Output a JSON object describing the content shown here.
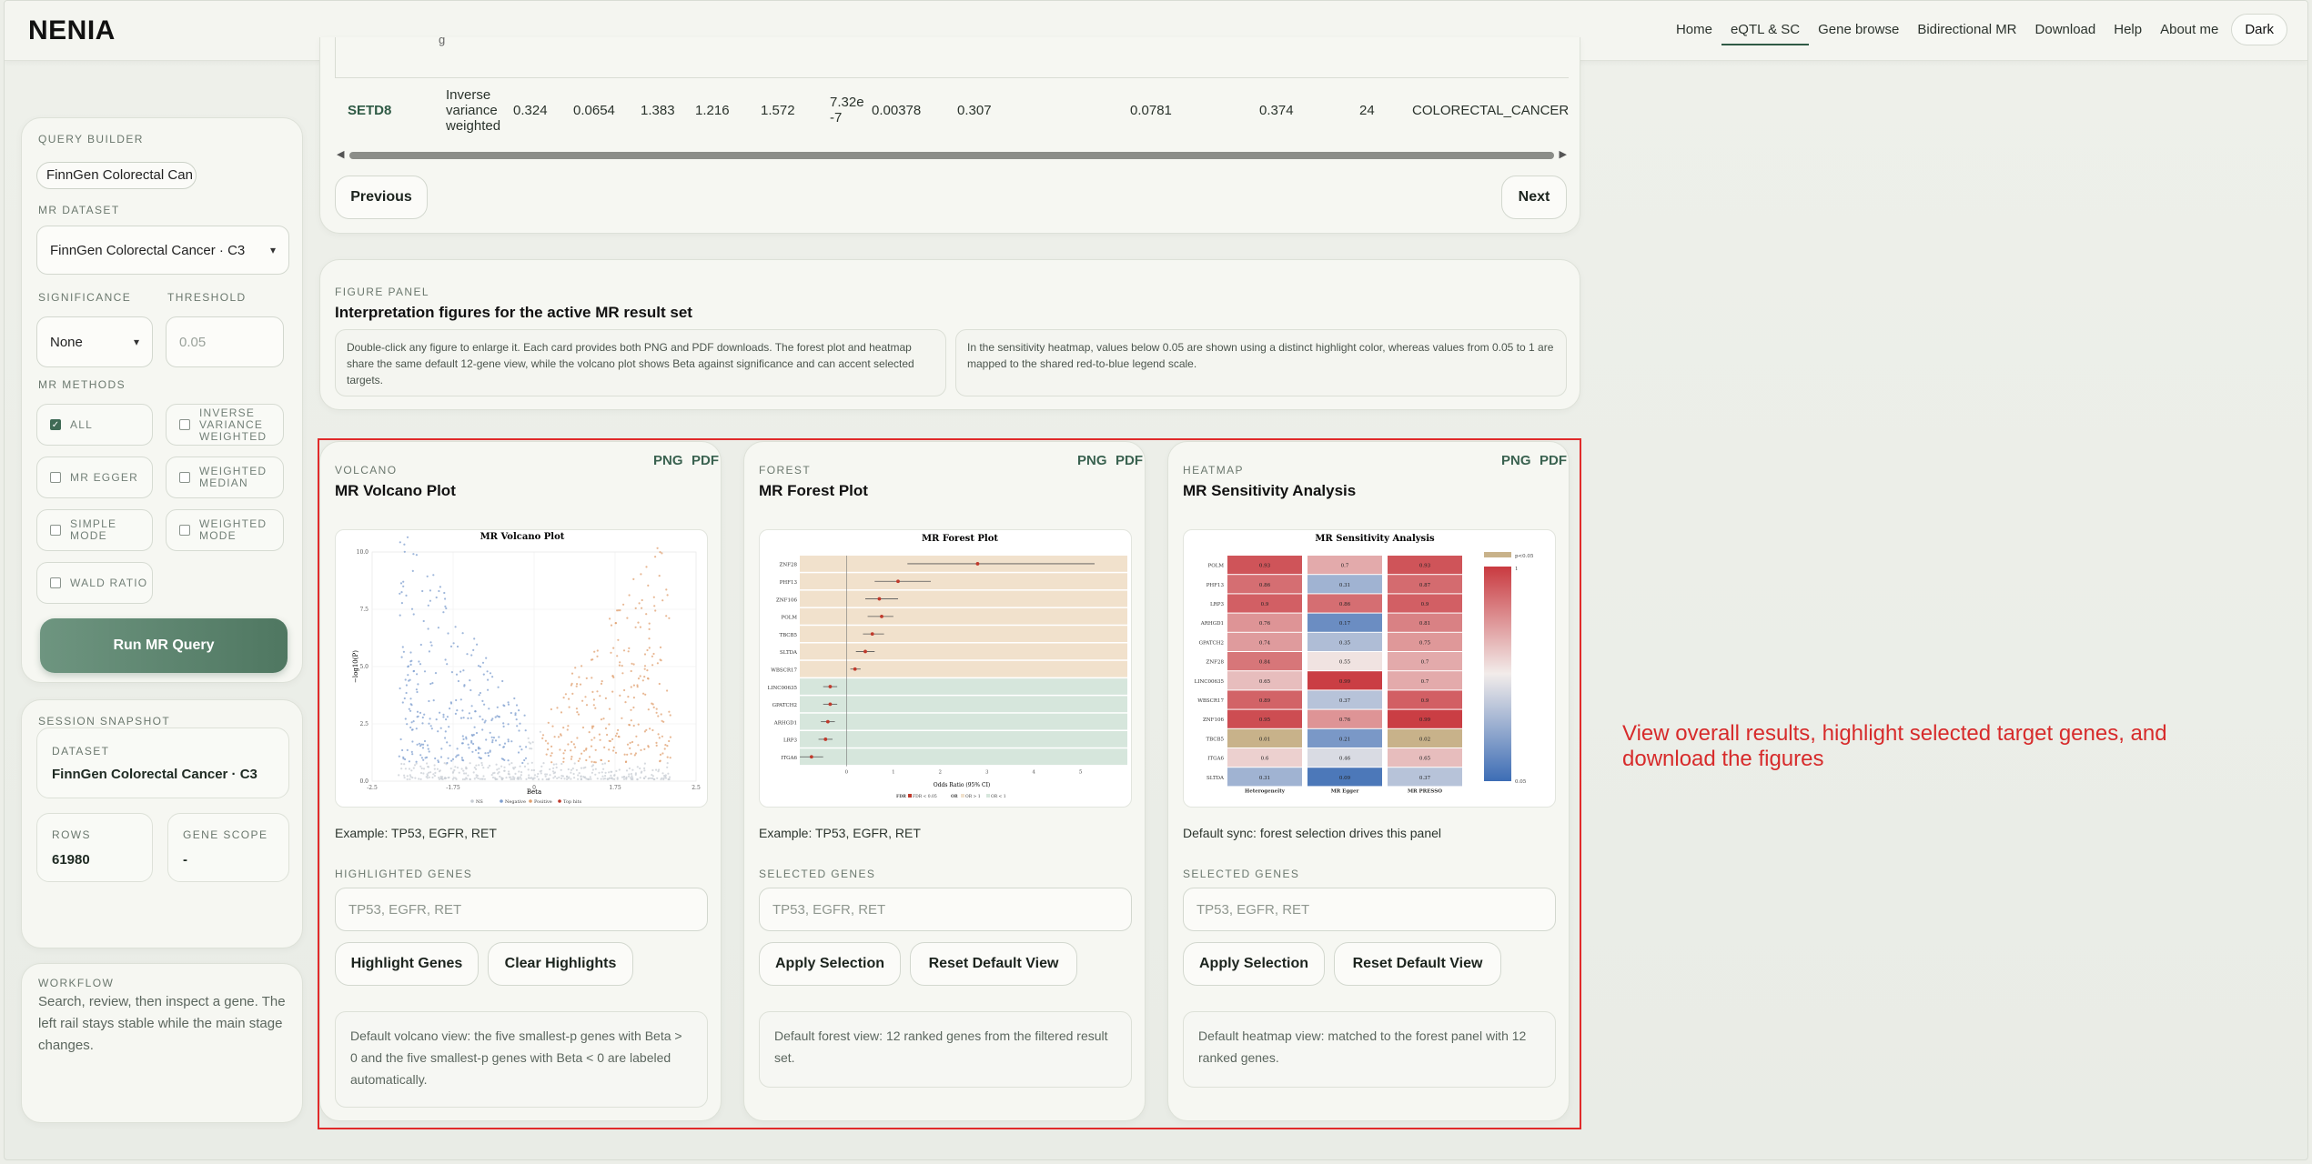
{
  "app": {
    "brand": "NENIA"
  },
  "nav": [
    {
      "label": "Home",
      "active": false
    },
    {
      "label": "eQTL & SC",
      "active": true
    },
    {
      "label": "Gene browse",
      "active": false
    },
    {
      "label": "Bidirectional MR",
      "active": false
    },
    {
      "label": "Download",
      "active": false
    },
    {
      "label": "Help",
      "active": false
    },
    {
      "label": "About me",
      "active": false
    }
  ],
  "theme_toggle": "Dark",
  "query": {
    "caption": "QUERY BUILDER",
    "dataset_pill": "FinnGen Colorectal Can",
    "mr_dataset_label": "MR DATASET",
    "mr_dataset_value": "FinnGen Colorectal Cancer · C3",
    "significance_label": "SIGNIFICANCE",
    "significance_value": "None",
    "threshold_label": "THRESHOLD",
    "threshold_placeholder": "0.05",
    "methods_label": "MR METHODS",
    "methods": [
      {
        "label": "ALL",
        "checked": true
      },
      {
        "label": "INVERSE VARIANCE WEIGHTED",
        "checked": false
      },
      {
        "label": "MR EGGER",
        "checked": false
      },
      {
        "label": "WEIGHTED MEDIAN",
        "checked": false
      },
      {
        "label": "SIMPLE MODE",
        "checked": false
      },
      {
        "label": "WEIGHTED MODE",
        "checked": false
      },
      {
        "label": "WALD RATIO",
        "checked": false
      }
    ],
    "run_button": "Run MR Query"
  },
  "snapshot": {
    "caption": "SESSION SNAPSHOT",
    "dataset_label": "DATASET",
    "dataset_value": "FinnGen Colorectal Cancer · C3",
    "rows_label": "ROWS",
    "rows_value": "61980",
    "scope_label": "GENE SCOPE",
    "scope_value": "-"
  },
  "workflow": {
    "caption": "WORKFLOW",
    "text": "Search, review, then inspect a gene. The left rail stays stable while the main stage changes."
  },
  "table": {
    "partial_row_text": "g",
    "row": {
      "gene": "SETD8",
      "method": "Inverse variance weighted",
      "c1": "0.324",
      "c2": "0.0654",
      "c3": "1.383",
      "c4": "1.216",
      "c5": "1.572",
      "pval": "7.32e-7",
      "c7": "0.00378",
      "c8": "0.307",
      "c9": "0.0781",
      "c10": "0.374",
      "nsnp": "24",
      "outcome": "COLORECTAL_CANCER"
    },
    "prev": "Previous",
    "next": "Next"
  },
  "figure_panel": {
    "caption": "FIGURE PANEL",
    "title": "Interpretation figures for the active MR result set",
    "note1": "Double-click any figure to enlarge it. Each card provides both PNG and PDF downloads. The forest plot and heatmap share the same default 12-gene view, while the volcano plot shows Beta against significance and can accent selected targets.",
    "note2": "In the sensitivity heatmap, values below 0.05 are shown using a distinct highlight color, whereas values from 0.05 to 1 are mapped to the shared red-to-blue legend scale."
  },
  "panels": {
    "volcano": {
      "caption": "VOLCANO",
      "title": "MR Volcano Plot",
      "png": "PNG",
      "pdf": "PDF",
      "example": "Example: TP53, EGFR, RET",
      "sel_label": "HIGHLIGHTED GENES",
      "placeholder": "TP53, EGFR, RET",
      "btn1": "Highlight Genes",
      "btn2": "Clear Highlights",
      "hint": "Default volcano view: the five smallest-p genes with Beta > 0 and the five smallest-p genes with Beta < 0 are labeled automatically."
    },
    "forest": {
      "caption": "FOREST",
      "title": "MR Forest Plot",
      "png": "PNG",
      "pdf": "PDF",
      "example": "Example: TP53, EGFR, RET",
      "sel_label": "SELECTED GENES",
      "placeholder": "TP53, EGFR, RET",
      "btn1": "Apply Selection",
      "btn2": "Reset Default View",
      "hint": "Default forest view: 12 ranked genes from the filtered result set."
    },
    "heatmap": {
      "caption": "HEATMAP",
      "title": "MR Sensitivity Analysis",
      "png": "PNG",
      "pdf": "PDF",
      "example": "Default sync: forest selection drives this panel",
      "sel_label": "SELECTED GENES",
      "placeholder": "TP53, EGFR, RET",
      "btn1": "Apply Selection",
      "btn2": "Reset Default View",
      "hint": "Default heatmap view: matched to the forest panel with 12 ranked genes."
    }
  },
  "volcano_plot": {
    "title": "MR Volcano Plot",
    "xlabel": "Beta",
    "ylabel": "−log10(P)",
    "xticks": [
      "-2.5",
      "-1.75",
      "0",
      "1.75",
      "2.5"
    ],
    "yticks": [
      "0.0",
      "2.5",
      "5.0",
      "7.5",
      "10.0"
    ],
    "legend": [
      "NS",
      "Negative",
      "Positive",
      "Top hits"
    ]
  },
  "forest_plot": {
    "title": "MR Forest Plot",
    "xlabel": "Odds Ratio (95% CI)",
    "genes": [
      "ZNF28",
      "PHF13",
      "ZNF106",
      "POLM",
      "TBCB5",
      "SLTDA",
      "WBSCR17",
      "LINC00635",
      "GPATCH2",
      "ARHGD1",
      "LRP3",
      "ITGA6"
    ],
    "or": [
      2.8,
      1.1,
      0.7,
      0.75,
      0.55,
      0.4,
      0.18,
      -0.35,
      -0.35,
      -0.4,
      -0.45,
      -0.75
    ],
    "lo": [
      1.3,
      0.6,
      0.4,
      0.45,
      0.35,
      0.2,
      0.08,
      -0.5,
      -0.5,
      -0.55,
      -0.6,
      -1.0
    ],
    "hi": [
      5.3,
      1.8,
      1.1,
      1.0,
      0.8,
      0.6,
      0.3,
      -0.2,
      -0.2,
      -0.25,
      -0.3,
      -0.5
    ],
    "direction": [
      "pos",
      "pos",
      "pos",
      "pos",
      "pos",
      "pos",
      "pos",
      "neg",
      "neg",
      "neg",
      "neg",
      "neg"
    ],
    "xticks": [
      "0",
      "1",
      "2",
      "3",
      "4",
      "5"
    ],
    "legend": [
      "FDR",
      "FDR < 0.05",
      "OR",
      "OR > 1",
      "OR < 1"
    ]
  },
  "heatmap_plot": {
    "title": "MR Sensitivity Analysis",
    "columns": [
      "Heterogeneity",
      "MR Egger",
      "MR PRESSO"
    ],
    "rows": [
      "POLM",
      "PHF13",
      "LRP3",
      "ARHGD1",
      "GPATCH2",
      "ZNF28",
      "LINC00635",
      "WBSCR17",
      "ZNF106",
      "TBCB5",
      "ITGA6",
      "SLTDA"
    ],
    "values": [
      [
        0.93,
        0.7,
        0.93
      ],
      [
        0.86,
        0.31,
        0.87
      ],
      [
        0.9,
        0.86,
        0.9
      ],
      [
        0.76,
        0.17,
        0.81
      ],
      [
        0.74,
        0.35,
        0.75
      ],
      [
        0.84,
        0.55,
        0.7
      ],
      [
        0.65,
        0.99,
        0.7
      ],
      [
        0.89,
        0.37,
        0.9
      ],
      [
        0.95,
        0.76,
        0.99
      ],
      [
        0.01,
        0.21,
        0.02
      ],
      [
        0.6,
        0.46,
        0.65
      ],
      [
        0.31,
        0.09,
        0.37
      ]
    ],
    "legend": {
      "sig": "p<0.05",
      "max": "1",
      "min": "0.05"
    },
    "colors": {
      "high": "#c93a40",
      "mid": "#f2ecea",
      "low": "#3d6db5",
      "sig": "#c8b28a"
    }
  },
  "annotation": "View overall results, highlight selected target genes, and download the figures"
}
